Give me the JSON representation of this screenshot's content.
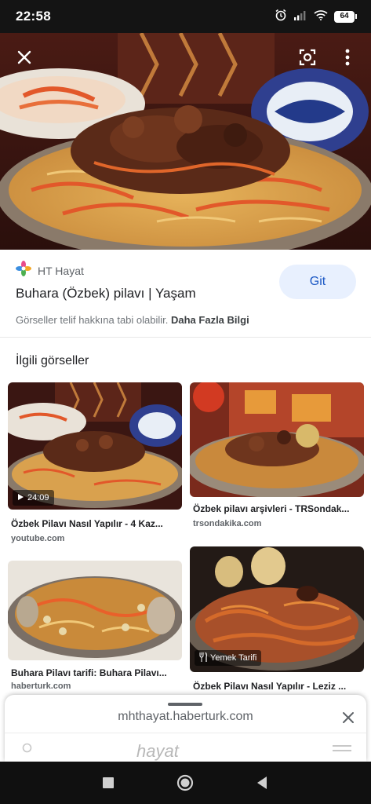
{
  "status_bar": {
    "time": "22:58",
    "battery": "64",
    "icons": [
      "alarm-icon",
      "signal-icon",
      "wifi-icon",
      "battery-icon"
    ]
  },
  "hero": {
    "icons": [
      "close-icon",
      "lens-icon",
      "more-vert-icon"
    ]
  },
  "result": {
    "source_name": "HT Hayat",
    "title": "Buhara (Özbek) pilavı | Yaşam",
    "go_label": "Git",
    "copyright_text": "Görseller telif hakkına tabi olabilir.",
    "more_info_link": "Daha Fazla Bilgi"
  },
  "related": {
    "heading": "İlgili görseller",
    "items": [
      {
        "title": "Özbek Pilavı Nasıl Yapılır - 4 Kaz...",
        "domain": "youtube.com",
        "badge": "24:09",
        "badge_icon": "play-icon"
      },
      {
        "title": "Özbek pilavı arşivleri - TRSondak...",
        "domain": "trsondakika.com"
      },
      {
        "title": "Buhara Pilavı tarifi: Buhara Pilavı...",
        "domain": "haberturk.com"
      },
      {
        "title": "Özbek Pilavı Nasıl Yapılır - Leziz ...",
        "domain": "",
        "badge": "Yemek Tarifi",
        "badge_icon": "utensils-icon"
      }
    ]
  },
  "sheet": {
    "url": "mhthayat.haberturk.com",
    "preview_logo": "hayat"
  },
  "nav": {
    "icons": [
      "recents-icon",
      "home-icon",
      "back-icon"
    ]
  },
  "colors": {
    "accent": "#1a57c4",
    "go_button_bg": "#e8f0fe"
  }
}
